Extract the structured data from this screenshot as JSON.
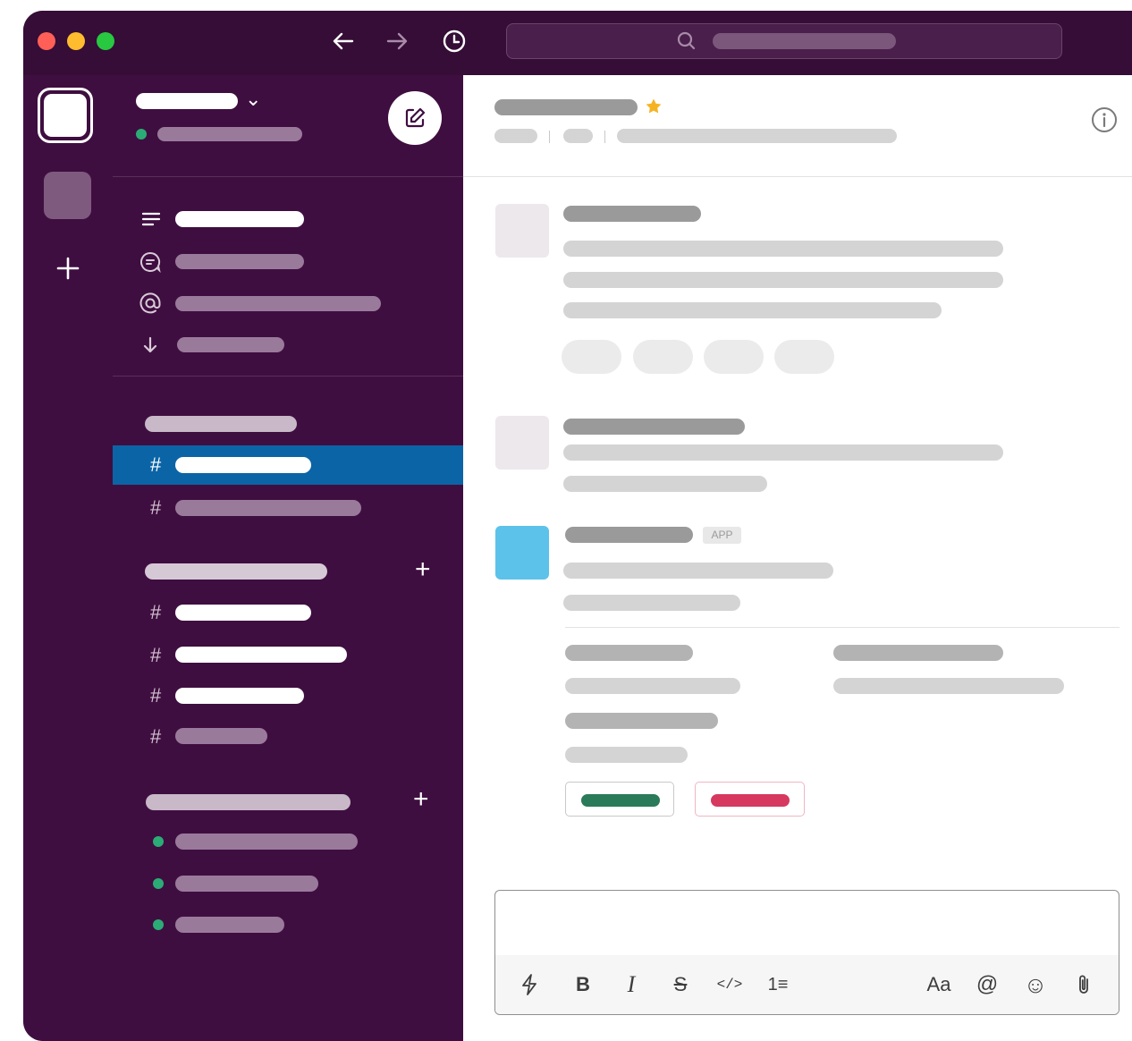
{
  "colors": {
    "sidebar": "#3f0e40",
    "titlebar": "#350d36",
    "selected_channel": "#0b64a6",
    "online": "#2bac76",
    "approve": "#2b7a59",
    "deny": "#d7385e",
    "app_avatar": "#5cc2ea",
    "star": "#f5b324"
  },
  "titlebar": {
    "traffic_lights": [
      "#ff5f57",
      "#febc2e",
      "#28c840"
    ],
    "icons": [
      "arrow-left-icon",
      "arrow-right-icon",
      "history-clock-icon",
      "search-icon"
    ]
  },
  "rail": {
    "icons": [
      "workspace-icon",
      "workspace-secondary-icon",
      "plus-icon"
    ]
  },
  "sidebar": {
    "icons": [
      "compose-icon",
      "threads-icon",
      "dms-icon",
      "mentions-icon",
      "drafts-icon"
    ],
    "channel_glyph": "#",
    "add_glyph": "+",
    "caret_glyph": "⌄"
  },
  "message": {
    "badge": "APP"
  },
  "composer": {
    "formatting": {
      "bold": "B",
      "italic": "I",
      "strike": "S",
      "code": "</>",
      "list": "1≡",
      "text_size": "Aa",
      "mention": "@",
      "emoji": "☺"
    }
  }
}
